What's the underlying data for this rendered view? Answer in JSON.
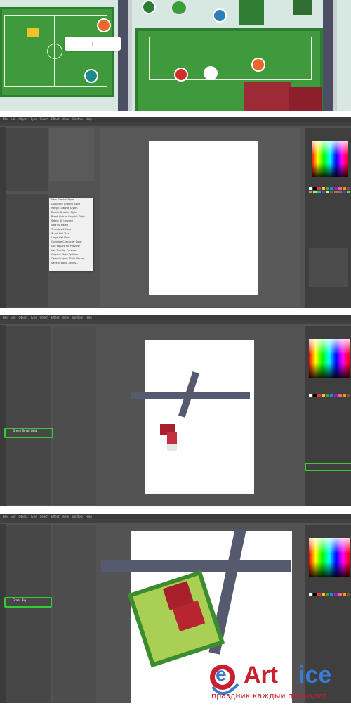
{
  "watermark": {
    "brand": "Art",
    "brand_suffix": "ice",
    "logo_letter": "e",
    "tagline": "праздник каждый приходит",
    "accent_red": "#c8202f",
    "accent_blue": "#3a7bd5"
  },
  "map_scene": {
    "tooltip_label": "+",
    "pins": [
      "soccer-pin-icon",
      "tennis-pin-icon",
      "gate-pin-icon",
      "basket-pin-icon",
      "trophy-pin-icon"
    ]
  },
  "screens": [
    {
      "name": "illustrator-contextmenu",
      "menu": [
        "File",
        "Edit",
        "Object",
        "Type",
        "Select",
        "Effect",
        "View",
        "Window",
        "Help"
      ],
      "context_menu": [
        "New Graphic Style...",
        "Duplicate Graphic Style",
        "Merge Graphic Styles",
        "Delete Graphic Style",
        "Break Link to Graphic Style",
        "Select All Unused",
        "Sort by Name",
        "Thumbnail View",
        "Small List View",
        "Large List View",
        "Override Character Color",
        "Use Square for Preview",
        "Use Text for Preview",
        "Graphic Style Options...",
        "Open Graphic Style Library",
        "Save Graphic Styles..."
      ]
    },
    {
      "name": "illustrator-road-assets",
      "menu": [
        "File",
        "Edit",
        "Object",
        "Type",
        "Select",
        "Effect",
        "View",
        "Window",
        "Help"
      ],
      "highlighted_item": "Green Small Grid"
    },
    {
      "name": "illustrator-lawn-house",
      "menu": [
        "File",
        "Edit",
        "Object",
        "Type",
        "Select",
        "Effect",
        "View",
        "Window",
        "Help"
      ],
      "highlighted_item": "Grass Big"
    }
  ],
  "colors": {
    "ui_dark": "#535353",
    "panel": "#474747",
    "highlight": "#33cc33",
    "road": "#4a4f63",
    "grass": "#3e9a3b",
    "lawn": "#a9cf55",
    "roof": "#a8202c"
  }
}
